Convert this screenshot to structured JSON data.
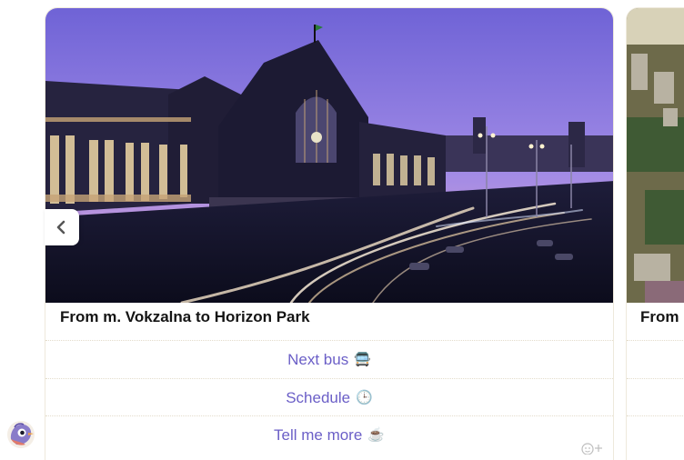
{
  "colors": {
    "accent": "#6b5fc7",
    "title": "#141414",
    "divider": "#e3dccb"
  },
  "carousel": {
    "prev_icon": "chevron-left-icon",
    "cards": [
      {
        "title": "From m. Vokzalna to Horizon Park",
        "image": "train-station-at-dusk",
        "buttons": [
          {
            "label": "Next bus",
            "icon": "bus-icon",
            "glyph": "🚍"
          },
          {
            "label": "Schedule",
            "icon": "clock-icon",
            "glyph": "🕒"
          },
          {
            "label": "Tell me more",
            "icon": "coffee-icon",
            "glyph": "☕"
          }
        ]
      },
      {
        "title": "From",
        "image": "aerial-city-view"
      }
    ]
  },
  "bot": {
    "avatar_icon": "bird-avatar-icon",
    "reaction_icon": "add-reaction-icon"
  }
}
